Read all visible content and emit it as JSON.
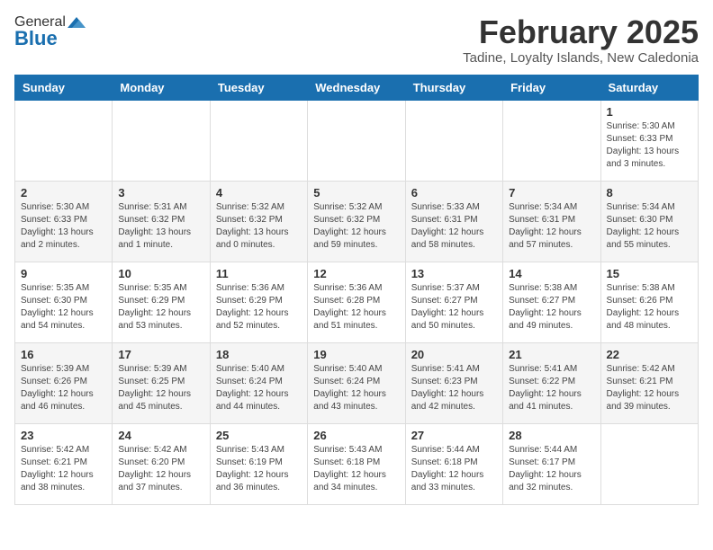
{
  "header": {
    "logo_general": "General",
    "logo_blue": "Blue",
    "month": "February 2025",
    "location": "Tadine, Loyalty Islands, New Caledonia"
  },
  "weekdays": [
    "Sunday",
    "Monday",
    "Tuesday",
    "Wednesday",
    "Thursday",
    "Friday",
    "Saturday"
  ],
  "weeks": [
    [
      {
        "day": "",
        "info": ""
      },
      {
        "day": "",
        "info": ""
      },
      {
        "day": "",
        "info": ""
      },
      {
        "day": "",
        "info": ""
      },
      {
        "day": "",
        "info": ""
      },
      {
        "day": "",
        "info": ""
      },
      {
        "day": "1",
        "info": "Sunrise: 5:30 AM\nSunset: 6:33 PM\nDaylight: 13 hours\nand 3 minutes."
      }
    ],
    [
      {
        "day": "2",
        "info": "Sunrise: 5:30 AM\nSunset: 6:33 PM\nDaylight: 13 hours\nand 2 minutes."
      },
      {
        "day": "3",
        "info": "Sunrise: 5:31 AM\nSunset: 6:32 PM\nDaylight: 13 hours\nand 1 minute."
      },
      {
        "day": "4",
        "info": "Sunrise: 5:32 AM\nSunset: 6:32 PM\nDaylight: 13 hours\nand 0 minutes."
      },
      {
        "day": "5",
        "info": "Sunrise: 5:32 AM\nSunset: 6:32 PM\nDaylight: 12 hours\nand 59 minutes."
      },
      {
        "day": "6",
        "info": "Sunrise: 5:33 AM\nSunset: 6:31 PM\nDaylight: 12 hours\nand 58 minutes."
      },
      {
        "day": "7",
        "info": "Sunrise: 5:34 AM\nSunset: 6:31 PM\nDaylight: 12 hours\nand 57 minutes."
      },
      {
        "day": "8",
        "info": "Sunrise: 5:34 AM\nSunset: 6:30 PM\nDaylight: 12 hours\nand 55 minutes."
      }
    ],
    [
      {
        "day": "9",
        "info": "Sunrise: 5:35 AM\nSunset: 6:30 PM\nDaylight: 12 hours\nand 54 minutes."
      },
      {
        "day": "10",
        "info": "Sunrise: 5:35 AM\nSunset: 6:29 PM\nDaylight: 12 hours\nand 53 minutes."
      },
      {
        "day": "11",
        "info": "Sunrise: 5:36 AM\nSunset: 6:29 PM\nDaylight: 12 hours\nand 52 minutes."
      },
      {
        "day": "12",
        "info": "Sunrise: 5:36 AM\nSunset: 6:28 PM\nDaylight: 12 hours\nand 51 minutes."
      },
      {
        "day": "13",
        "info": "Sunrise: 5:37 AM\nSunset: 6:27 PM\nDaylight: 12 hours\nand 50 minutes."
      },
      {
        "day": "14",
        "info": "Sunrise: 5:38 AM\nSunset: 6:27 PM\nDaylight: 12 hours\nand 49 minutes."
      },
      {
        "day": "15",
        "info": "Sunrise: 5:38 AM\nSunset: 6:26 PM\nDaylight: 12 hours\nand 48 minutes."
      }
    ],
    [
      {
        "day": "16",
        "info": "Sunrise: 5:39 AM\nSunset: 6:26 PM\nDaylight: 12 hours\nand 46 minutes."
      },
      {
        "day": "17",
        "info": "Sunrise: 5:39 AM\nSunset: 6:25 PM\nDaylight: 12 hours\nand 45 minutes."
      },
      {
        "day": "18",
        "info": "Sunrise: 5:40 AM\nSunset: 6:24 PM\nDaylight: 12 hours\nand 44 minutes."
      },
      {
        "day": "19",
        "info": "Sunrise: 5:40 AM\nSunset: 6:24 PM\nDaylight: 12 hours\nand 43 minutes."
      },
      {
        "day": "20",
        "info": "Sunrise: 5:41 AM\nSunset: 6:23 PM\nDaylight: 12 hours\nand 42 minutes."
      },
      {
        "day": "21",
        "info": "Sunrise: 5:41 AM\nSunset: 6:22 PM\nDaylight: 12 hours\nand 41 minutes."
      },
      {
        "day": "22",
        "info": "Sunrise: 5:42 AM\nSunset: 6:21 PM\nDaylight: 12 hours\nand 39 minutes."
      }
    ],
    [
      {
        "day": "23",
        "info": "Sunrise: 5:42 AM\nSunset: 6:21 PM\nDaylight: 12 hours\nand 38 minutes."
      },
      {
        "day": "24",
        "info": "Sunrise: 5:42 AM\nSunset: 6:20 PM\nDaylight: 12 hours\nand 37 minutes."
      },
      {
        "day": "25",
        "info": "Sunrise: 5:43 AM\nSunset: 6:19 PM\nDaylight: 12 hours\nand 36 minutes."
      },
      {
        "day": "26",
        "info": "Sunrise: 5:43 AM\nSunset: 6:18 PM\nDaylight: 12 hours\nand 34 minutes."
      },
      {
        "day": "27",
        "info": "Sunrise: 5:44 AM\nSunset: 6:18 PM\nDaylight: 12 hours\nand 33 minutes."
      },
      {
        "day": "28",
        "info": "Sunrise: 5:44 AM\nSunset: 6:17 PM\nDaylight: 12 hours\nand 32 minutes."
      },
      {
        "day": "",
        "info": ""
      }
    ]
  ]
}
